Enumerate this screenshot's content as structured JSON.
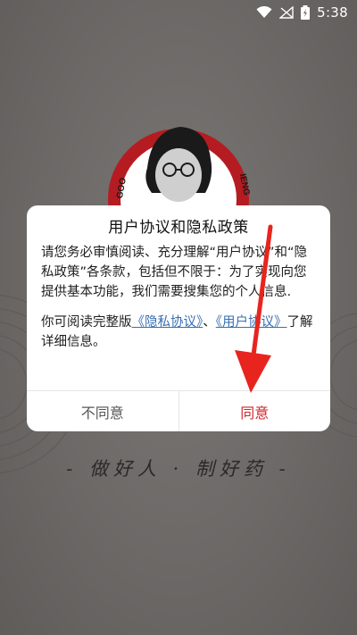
{
  "status_bar": {
    "time": "5:38"
  },
  "logo": {
    "text_left": "GOO",
    "text_right": "IENG"
  },
  "dialog": {
    "title": "用户协议和隐私政策",
    "paragraph1": "请您务必审慎阅读、充分理解“用户协议”和“隐私政策”各条款，包括但不限于：为了实现向您提供基本功能，我们需要搜集您的个人信息.",
    "paragraph2_prefix": "你可阅读完整版",
    "privacy_link": "《隐私协议》",
    "separator": "、",
    "user_link": "《用户协议》",
    "paragraph2_suffix": "了解详细信息。",
    "disagree_label": "不同意",
    "agree_label": "同意"
  },
  "slogan": "- 做好人 · 制好药 -",
  "colors": {
    "accent": "#d4242a",
    "link": "#3a6fb3",
    "arrow": "#e8241e"
  }
}
